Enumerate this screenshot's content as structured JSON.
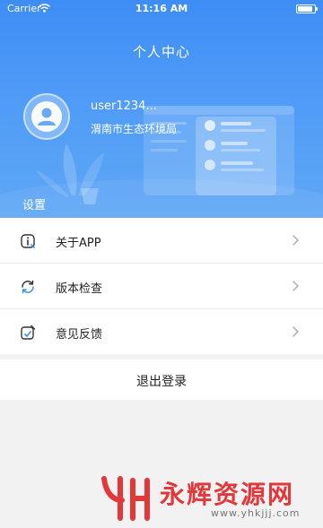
{
  "status_bar": {
    "carrier": "Carrier",
    "time": "11:16 AM"
  },
  "header": {
    "title": "个人中心",
    "username": "user1234...",
    "organization": "渭南市生态环境局"
  },
  "section_title": "设置",
  "menu": [
    {
      "label": "关于APP",
      "icon": "info-icon"
    },
    {
      "label": "版本检查",
      "icon": "refresh-icon"
    },
    {
      "label": "意见反馈",
      "icon": "feedback-icon"
    }
  ],
  "logout_label": "退出登录",
  "watermark": {
    "brand": "永辉资源网",
    "url": "www.yhkjjj.com"
  },
  "colors": {
    "header_blue": "#3d8df5",
    "watermark_red": "#e3373a"
  }
}
